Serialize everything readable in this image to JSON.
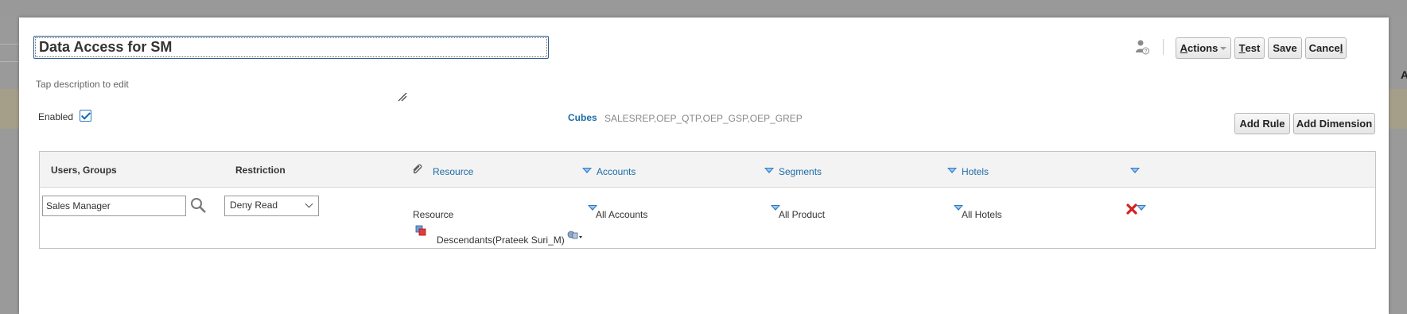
{
  "background": {
    "right_edge_text": "A"
  },
  "dialog": {
    "title": "Data Access for SM",
    "description_placeholder": "Tap description to edit",
    "enabled_label": "Enabled",
    "enabled": true,
    "cubes_label": "Cubes",
    "cubes_value": "SALESREP,OEP_QTP,OEP_GSP,OEP_GREP",
    "toolbar": {
      "actions_label": "Actions",
      "actions_mnemonic": "A",
      "test_label": "Test",
      "test_mnemonic": "T",
      "save_label": "Save",
      "cancel_label": "Cancel",
      "cancel_mnemonic": "l"
    },
    "add_rule_label": "Add Rule",
    "add_dimension_label": "Add Dimension",
    "grid": {
      "headers": {
        "users_groups": "Users, Groups",
        "restriction": "Restriction",
        "resource": "Resource",
        "accounts": "Accounts",
        "segments": "Segments",
        "hotels": "Hotels"
      },
      "row": {
        "user": "Sales Manager",
        "restriction": "Deny Read",
        "resource": "Resource",
        "accounts": "All Accounts",
        "segments": "All Product",
        "hotels": "All Hotels",
        "resource_member": "Descendants(Prateek Suri_M)"
      }
    }
  },
  "colors": {
    "accent": "#1b6aa5",
    "focus_border": "#2f5f95",
    "delete": "#d42020"
  },
  "icons": [
    "person-help-icon",
    "resize-handle-icon",
    "paperclip-icon",
    "dropdown-triangle-icon",
    "search-icon",
    "chevron-down-icon",
    "member-function-icon",
    "member-selector-icon",
    "delete-icon"
  ]
}
